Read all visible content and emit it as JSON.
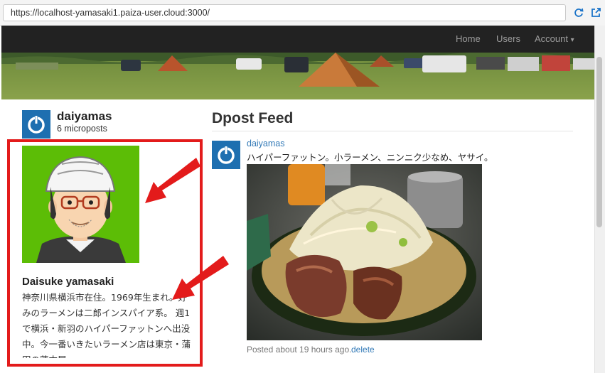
{
  "browser": {
    "url": "https://localhost-yamasaki1.paiza-user.cloud:3000/"
  },
  "navbar": {
    "home_label": "Home",
    "users_label": "Users",
    "account_label": "Account",
    "caret": "▾"
  },
  "sidebar": {
    "user_name": "daiyamas",
    "micropost_count": "6 microposts",
    "profile_name": "Daisuke yamasaki",
    "profile_bio": "神奈川県横浜市在住。1969年生まれ。好みのラーメンは二郎インスパイア系。 週1で横浜・新羽のハイパーファットンへ出没中。今一番いきたいラーメン店は東京・蒲田の蓮本屋"
  },
  "feed": {
    "title": "Dpost Feed",
    "post": {
      "user": "daiyamas",
      "content": "ハイパーファットン。小ラーメン、ニンニク少なめ、ヤサイ。",
      "timestamp": "Posted about 19 hours ago.",
      "delete_label": "delete"
    }
  },
  "colors": {
    "navbar_bg": "#222222",
    "link": "#337ab7",
    "annotation_red": "#e31b1b",
    "avatar_bg": "#5cbd06",
    "gravatar_blue": "#1e6fb0"
  }
}
